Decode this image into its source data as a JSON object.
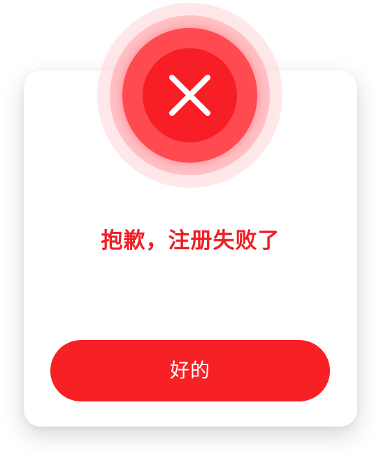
{
  "dialog": {
    "icon": "close-icon",
    "message": "抱歉，注册失败了",
    "confirm_label": "好的"
  },
  "colors": {
    "accent": "#f72024",
    "title_text": "#ef1f26",
    "button_text": "#ffffff",
    "card_background": "#ffffff"
  }
}
